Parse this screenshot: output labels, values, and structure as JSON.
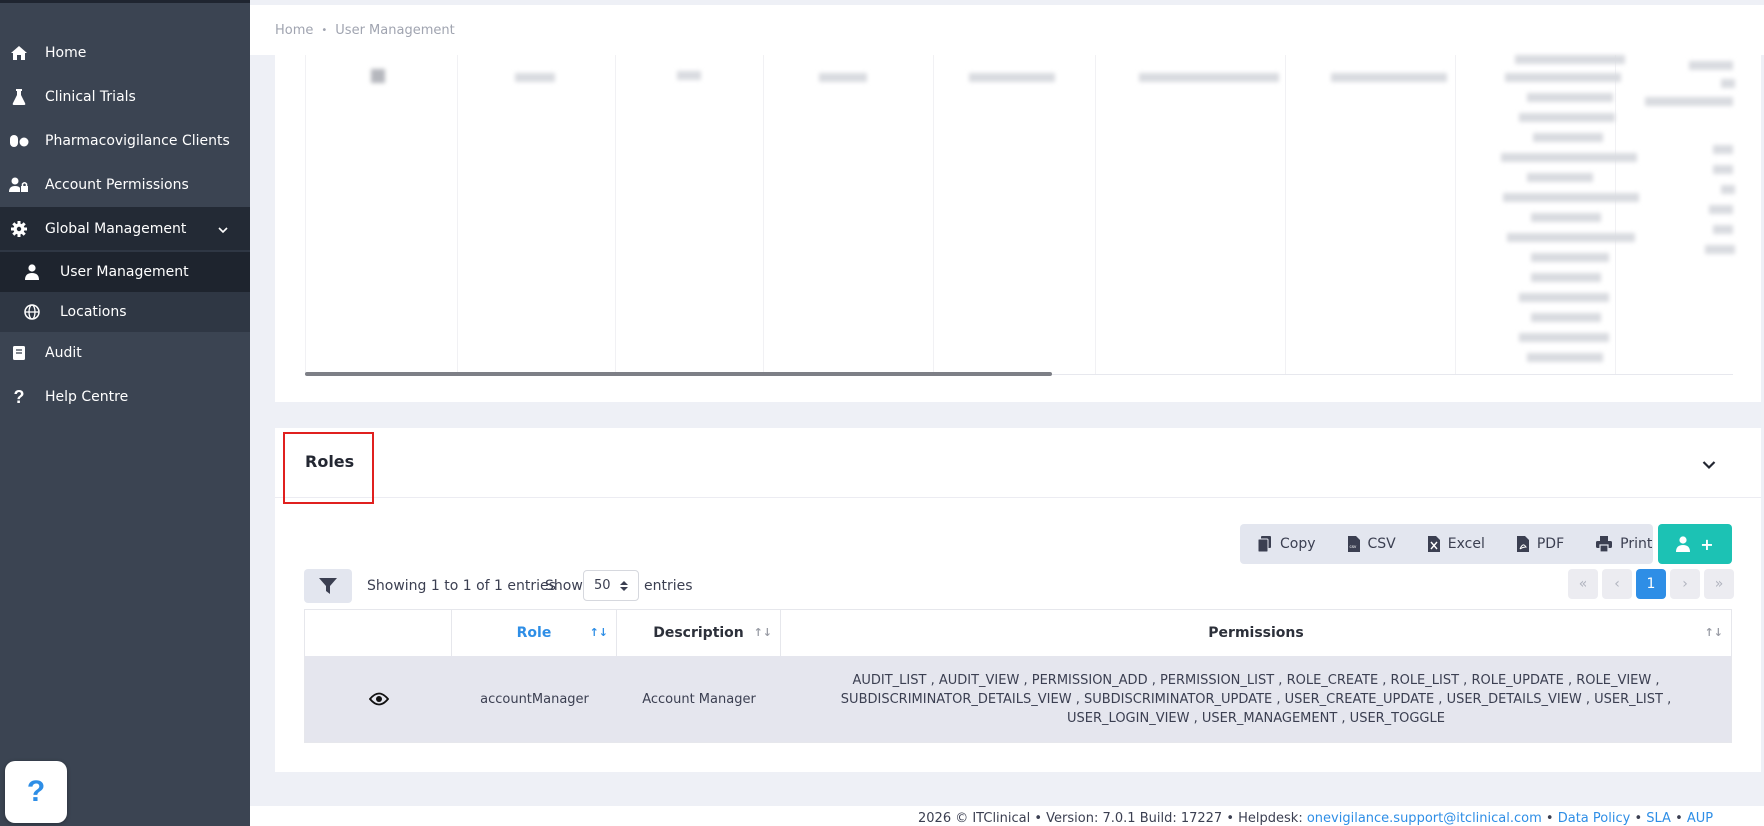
{
  "sidebar": {
    "items": [
      {
        "label": "Home",
        "icon": "home-icon"
      },
      {
        "label": "Clinical Trials",
        "icon": "flask-icon"
      },
      {
        "label": "Pharmacovigilance Clients",
        "icon": "pills-icon"
      },
      {
        "label": "Account Permissions",
        "icon": "user-lock-icon"
      },
      {
        "label": "Global Management",
        "icon": "gear-icon"
      },
      {
        "label": "Audit",
        "icon": "book-icon"
      },
      {
        "label": "Help Centre",
        "icon": "question-icon"
      }
    ],
    "subitems": [
      {
        "label": "User Management",
        "icon": "user-icon"
      },
      {
        "label": "Locations",
        "icon": "globe-icon"
      }
    ],
    "help_fab": "?"
  },
  "breadcrumb": {
    "home": "Home",
    "separator": "•",
    "current": "User Management"
  },
  "roles": {
    "title": "Roles",
    "toolbar": {
      "copy": "Copy",
      "csv": "CSV",
      "excel": "Excel",
      "pdf": "PDF",
      "print": "Print",
      "add": "+"
    },
    "info": "Showing 1 to 1 of 1 entries",
    "show_label": "Show",
    "page_size": "50",
    "entries_label": "entries",
    "pagination": {
      "first": "«",
      "prev": "‹",
      "current": "1",
      "next": "›",
      "last": "»"
    },
    "columns": {
      "role": "Role",
      "description": "Description",
      "permissions": "Permissions"
    },
    "sort_icon": "↑↓",
    "row": {
      "role": "accountManager",
      "description": "Account Manager",
      "permissions": "AUDIT_LIST , AUDIT_VIEW , PERMISSION_ADD , PERMISSION_LIST , ROLE_CREATE , ROLE_LIST , ROLE_UPDATE , ROLE_VIEW , SUBDISCRIMINATOR_DETAILS_VIEW , SUBDISCRIMINATOR_UPDATE , USER_CREATE_UPDATE , USER_DETAILS_VIEW , USER_LIST , USER_LOGIN_VIEW , USER_MANAGEMENT , USER_TOGGLE"
    }
  },
  "footer": {
    "text": "2026 © ITClinical •  Version: 7.0.1 Build: 17227  • Helpdesk:",
    "email": "onevigilance.support@itclinical.com",
    "sep": "•",
    "data_policy": "Data Policy",
    "sla": "SLA",
    "aup": "AUP"
  },
  "colors": {
    "accent": "#2e8ee6",
    "add_button": "#1cc2b4",
    "sidebar": "#3b4452",
    "highlight": "#e0201f"
  }
}
